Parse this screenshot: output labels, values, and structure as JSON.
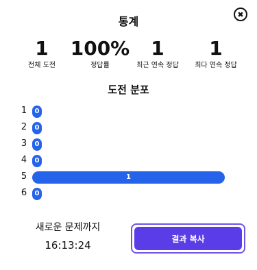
{
  "header": {
    "title": "통계",
    "close_icon": "close-icon",
    "close_glyph": "✖"
  },
  "stats": [
    {
      "value": "1",
      "label": "전체 도전"
    },
    {
      "value": "100%",
      "label": "정답률"
    },
    {
      "value": "1",
      "label": "최근 연속 정답"
    },
    {
      "value": "1",
      "label": "최다 연속 정답"
    }
  ],
  "distribution": {
    "title": "도전 분포",
    "rows": [
      {
        "guess": "1",
        "count": 0
      },
      {
        "guess": "2",
        "count": 0
      },
      {
        "guess": "3",
        "count": 0
      },
      {
        "guess": "4",
        "count": 0
      },
      {
        "guess": "5",
        "count": 1
      },
      {
        "guess": "6",
        "count": 0
      }
    ],
    "bar_color": "#2563eb"
  },
  "countdown": {
    "label": "새로운 문제까지",
    "time": "16:13:24"
  },
  "share": {
    "label": "결과 복사",
    "color": "#5a3de6"
  }
}
